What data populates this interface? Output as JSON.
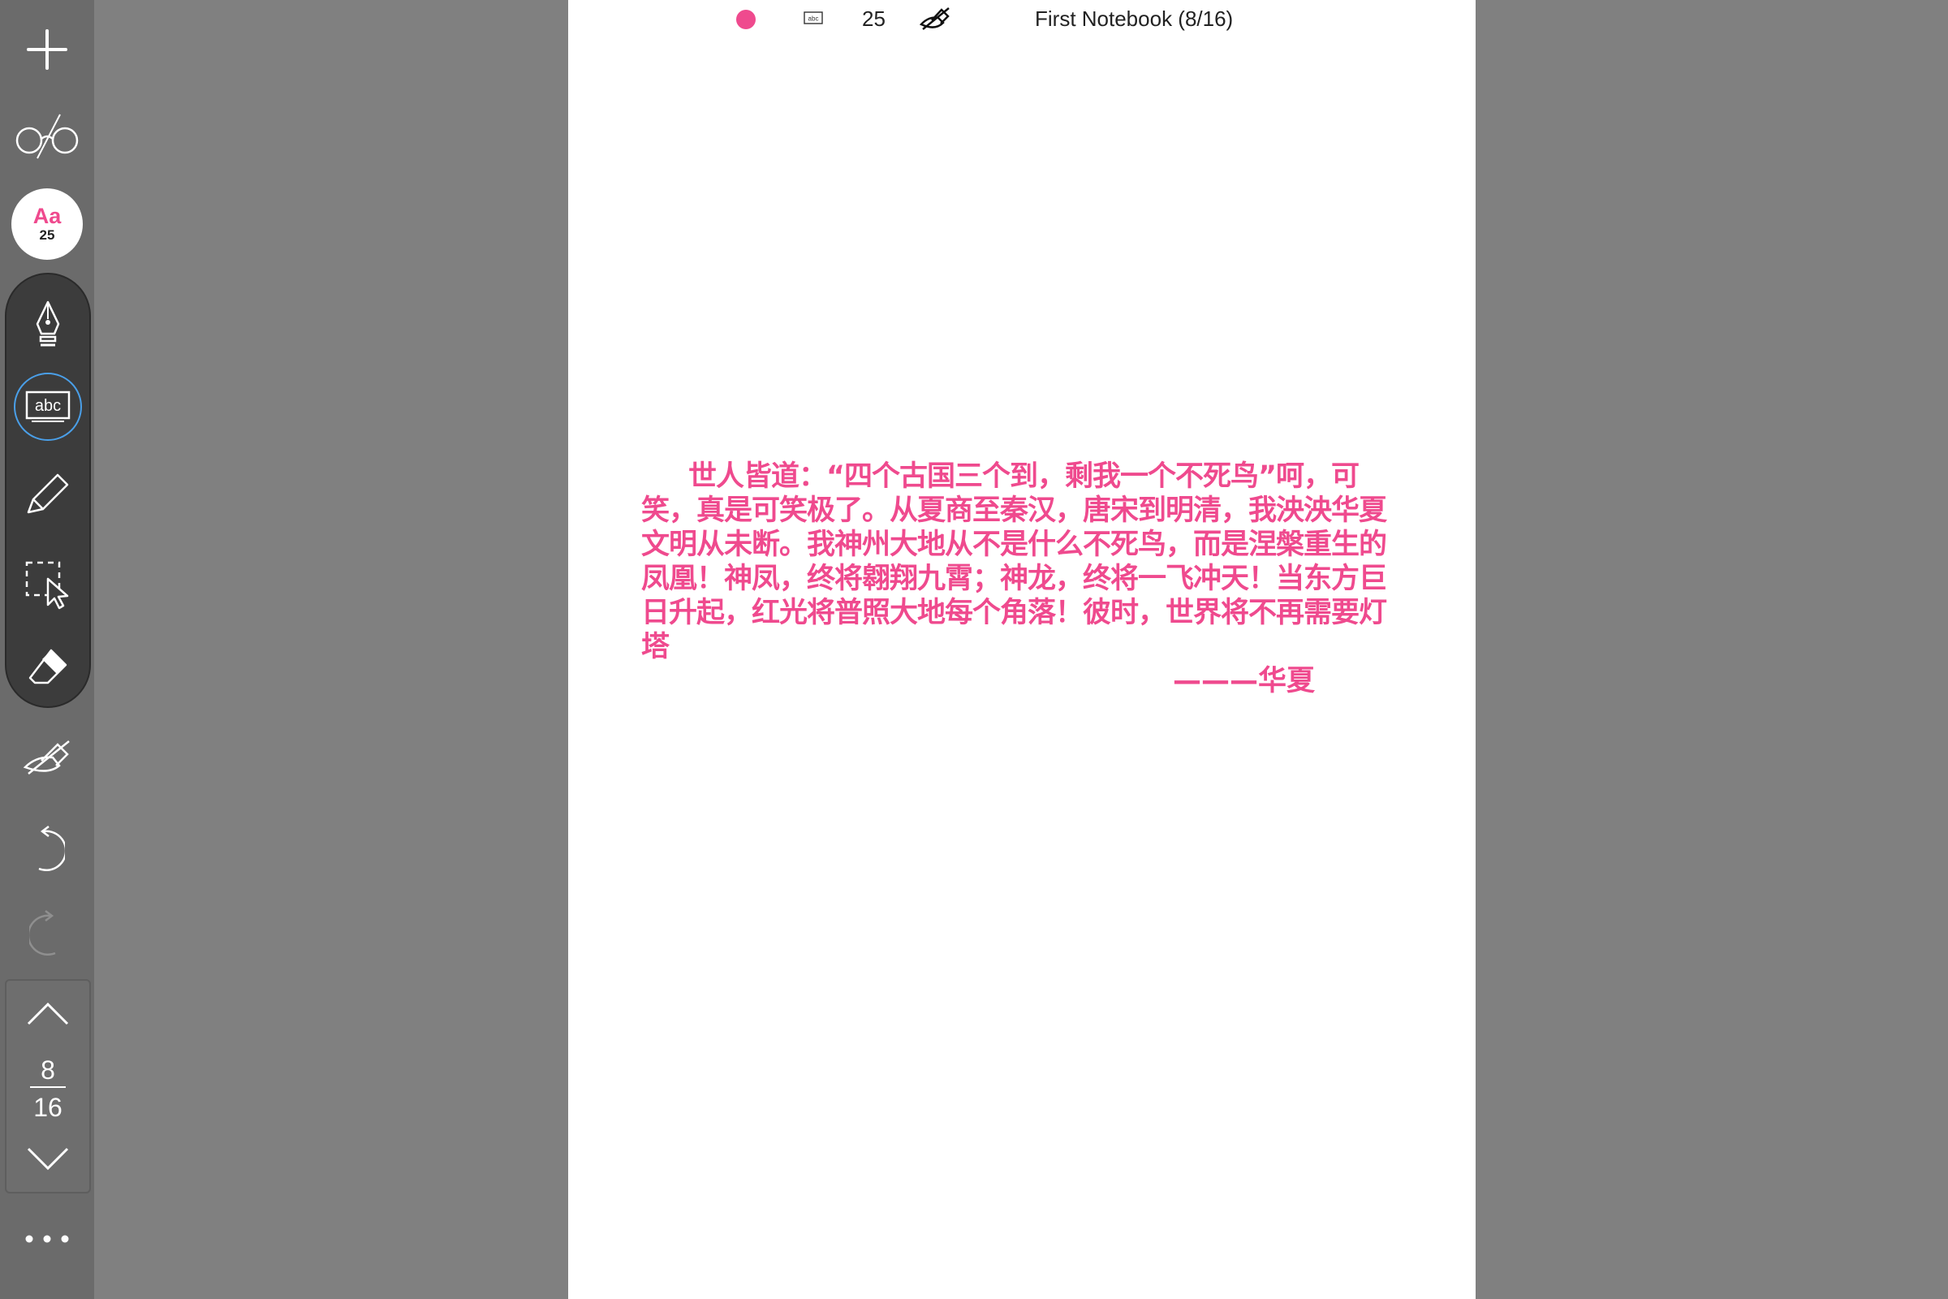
{
  "status_bar": {
    "text_color": "#ef4a8e",
    "mode_icon": "text-box-icon",
    "font_size": "25",
    "hide_icon": "hide-pen-icon",
    "notebook_title": "First Notebook (8/16)"
  },
  "sidebar": {
    "add_icon": "plus-icon",
    "read_icon": "glasses-icon",
    "font_button": {
      "label": "Aa",
      "size": "25",
      "color": "#ef4a8e"
    },
    "tools": [
      {
        "name": "pen",
        "icon": "fountain-pen-icon",
        "active": false
      },
      {
        "name": "text",
        "icon": "abc-text-icon",
        "label": "abc",
        "active": true
      },
      {
        "name": "highlighter",
        "icon": "highlighter-icon",
        "active": false
      },
      {
        "name": "select",
        "icon": "lasso-select-icon",
        "active": false
      },
      {
        "name": "eraser",
        "icon": "eraser-icon",
        "active": false
      }
    ],
    "hide_ink_icon": "hide-ink-icon",
    "undo_icon": "undo-icon",
    "redo_icon": "redo-icon",
    "page_nav": {
      "current": "8",
      "total": "16"
    },
    "more_icon": "more-icon"
  },
  "document": {
    "paragraph": "世人皆道：“四个古国三个到，剩我一个不死鸟”呵，可笑，真是可笑极了。从夏商至秦汉，唐宋到明清，我泱泱华夏文明从未断。我神州大地从不是什么不死鸟，而是涅槃重生的凤凰！神凤，终将翱翔九霄；神龙，终将一飞冲天！当东方巨日升起，红光将普照大地每个角落！彼时，世界将不再需要灯塔",
    "signature": "———华夏"
  },
  "accent_colors": {
    "ink": "#ef4a8e",
    "active_ring": "#4a9fe8"
  }
}
